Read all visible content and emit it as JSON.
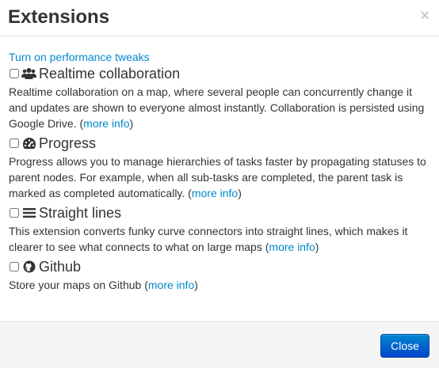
{
  "dialog": {
    "title": "Extensions",
    "close_glyph": "×"
  },
  "perf_link": "Turn on performance tweaks",
  "extensions": [
    {
      "name": "Realtime collaboration",
      "icon": "users-icon",
      "desc": "Realtime collaboration on a map, where several people can concurrently change it and updates are shown to everyone almost instantly. Collaboration is persisted using Google Drive. (",
      "link": "more info",
      "desc_end": ")"
    },
    {
      "name": "Progress",
      "icon": "dashboard-icon",
      "desc": "Progress allows you to manage hierarchies of tasks faster by propagating statuses to parent nodes. For example, when all sub-tasks are completed, the parent task is marked as completed automatically. (",
      "link": "more info",
      "desc_end": ")"
    },
    {
      "name": "Straight lines",
      "icon": "list-icon",
      "desc": "This extension converts funky curve connectors into straight lines, which makes it clearer to see what connects to what on large maps (",
      "link": "more info",
      "desc_end": ")"
    },
    {
      "name": "Github",
      "icon": "github-icon",
      "desc": "Store your maps on Github (",
      "link": "more info",
      "desc_end": ")"
    }
  ],
  "footer": {
    "close_label": "Close"
  },
  "colors": {
    "link": "#0088cc",
    "primary": "#0055cc"
  }
}
